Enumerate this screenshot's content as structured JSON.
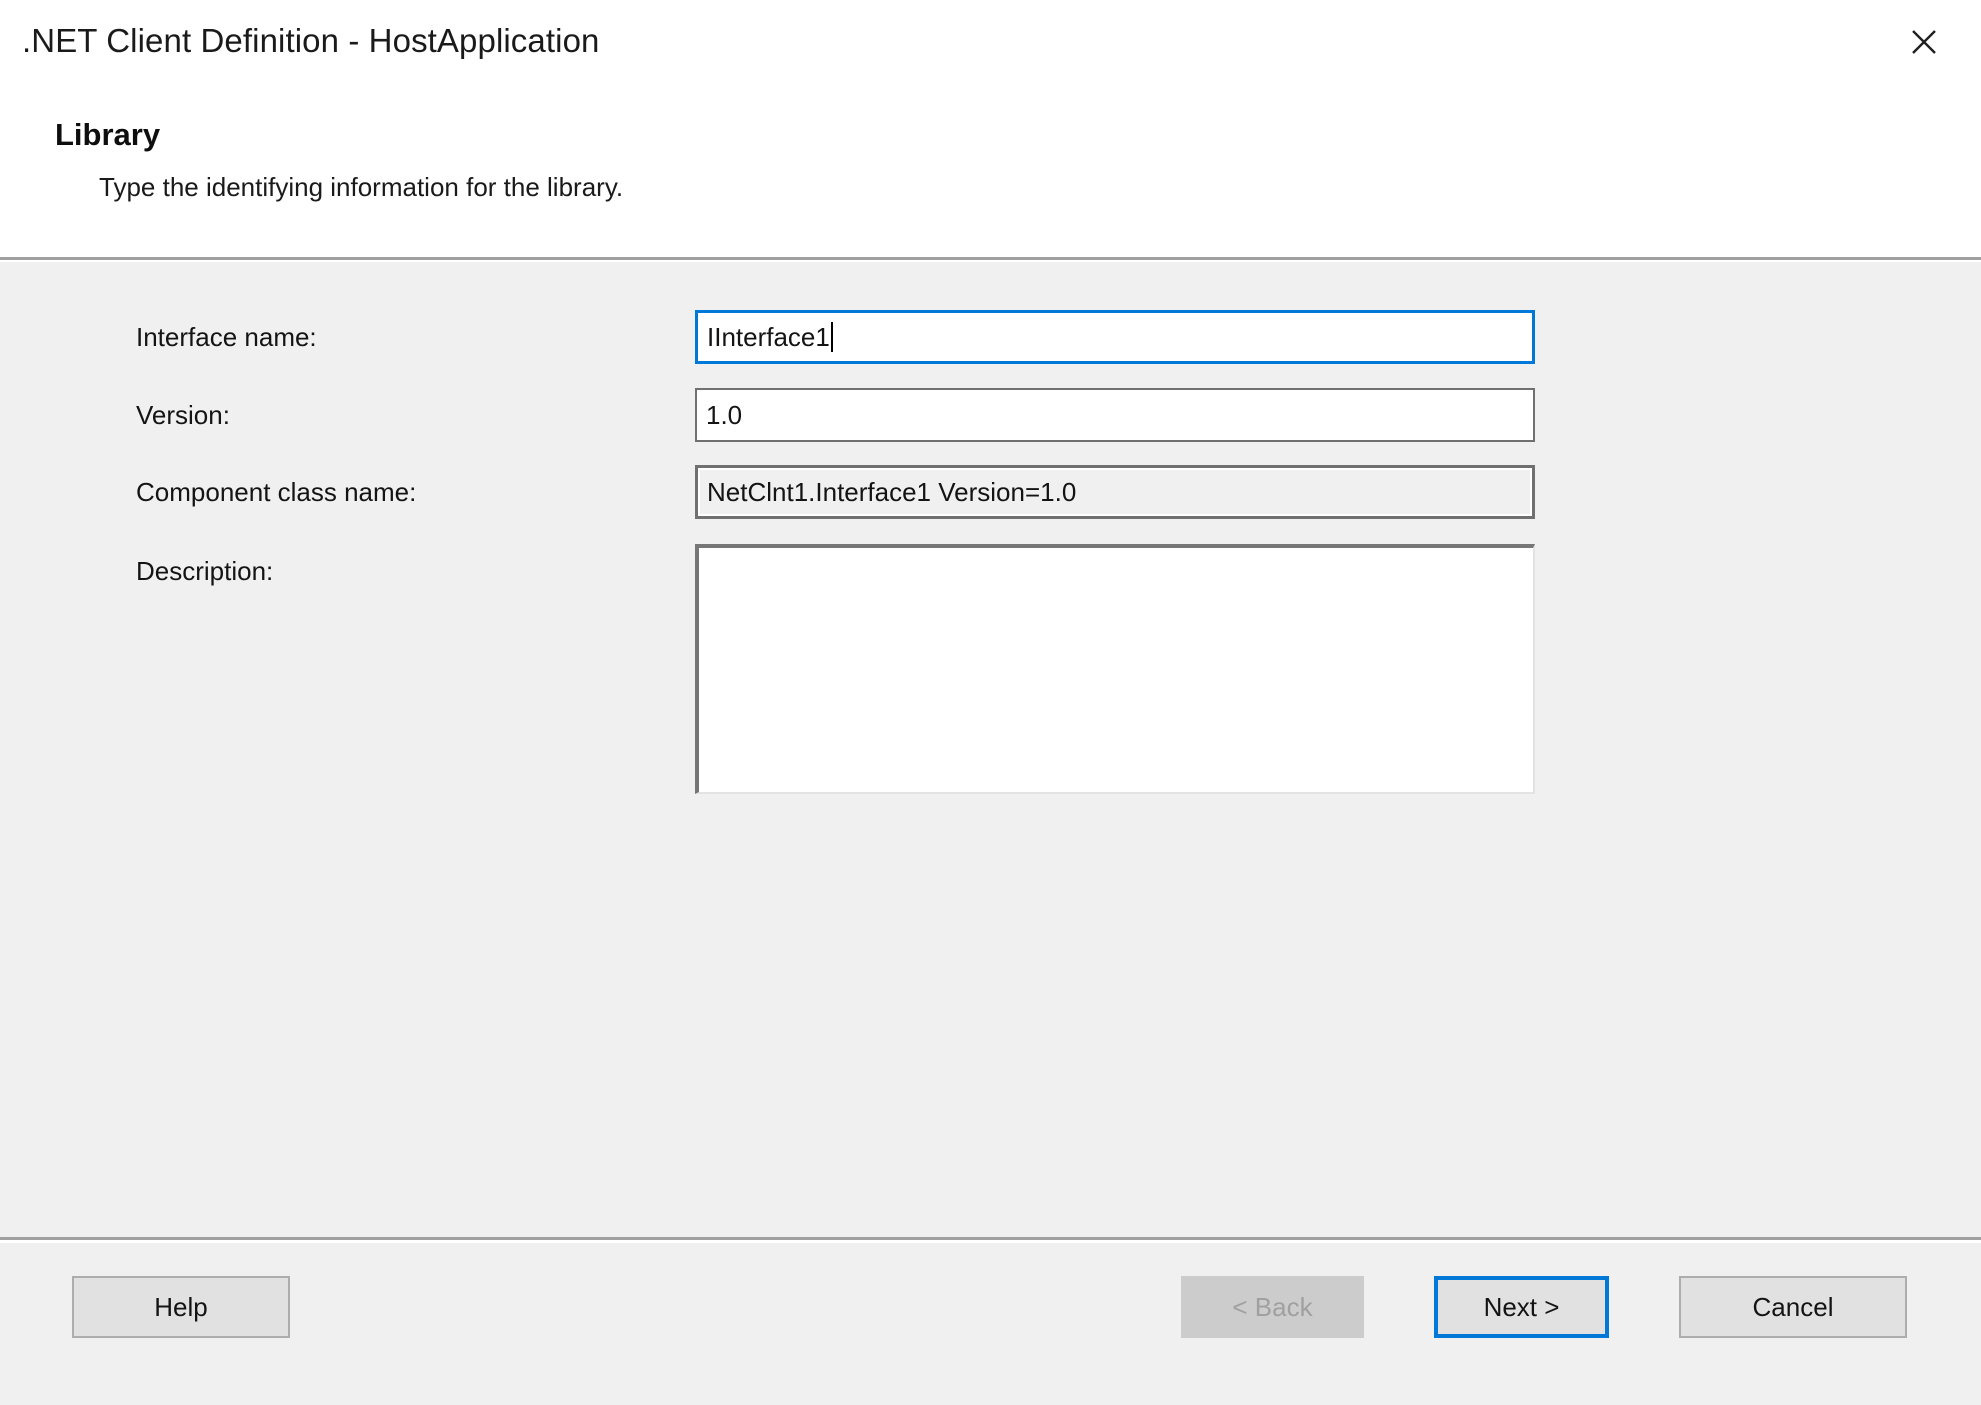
{
  "window": {
    "title": ".NET Client Definition - HostApplication",
    "close_icon": "close-icon"
  },
  "header": {
    "heading": "Library",
    "subtitle": "Type the identifying information for the library."
  },
  "form": {
    "fields": [
      {
        "label": "Interface name:",
        "value": "IInterface1",
        "placeholder": "",
        "state": "focused",
        "type": "text"
      },
      {
        "label": "Version:",
        "value": "1.0",
        "placeholder": "",
        "state": "normal",
        "type": "text"
      },
      {
        "label": "Component class name:",
        "value": "NetClnt1.Interface1 Version=1.0",
        "placeholder": "",
        "state": "readonly",
        "type": "text"
      },
      {
        "label": "Description:",
        "value": "",
        "placeholder": "",
        "state": "normal",
        "type": "textarea"
      }
    ]
  },
  "footer": {
    "help_label": "Help",
    "back_label": "< Back",
    "next_label": "Next >",
    "cancel_label": "Cancel"
  },
  "colors": {
    "accent": "#0078d7",
    "dialog_background": "#f0f0f0",
    "header_background": "#ffffff",
    "separator": "#a0a0a0",
    "button_face": "#e1e1e1",
    "disabled_face": "#cccccc",
    "disabled_text": "#a0a0a0",
    "field_border": "#707070",
    "text": "#141414"
  }
}
